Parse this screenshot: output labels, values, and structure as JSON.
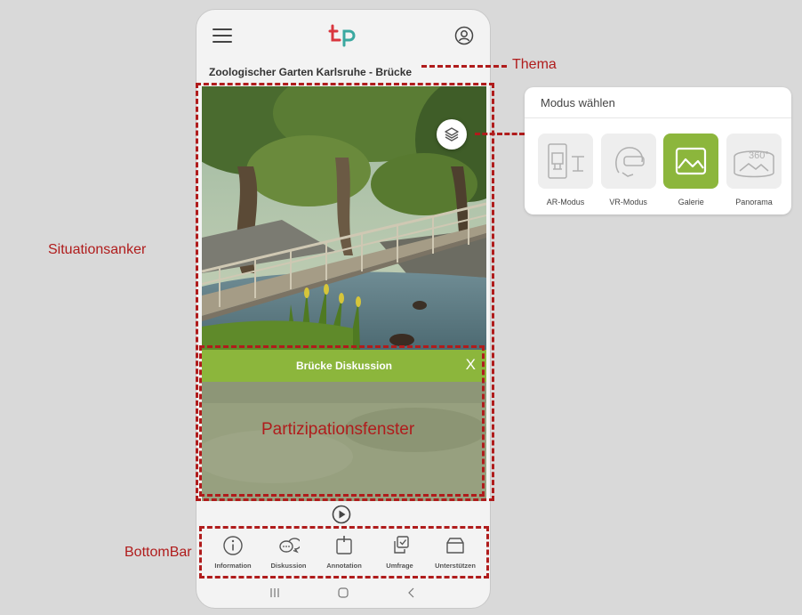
{
  "topic": "Zoologischer Garten Karlsruhe -  Brücke",
  "panel": {
    "title": "Brücke Diskussion",
    "close": "X"
  },
  "annotations": {
    "thema": "Thema",
    "situationsanker": "Situationsanker",
    "partizipationsfenster": "Partizipationsfenster",
    "bottombar": "BottomBar"
  },
  "bottom_nav": [
    {
      "label": "Information",
      "icon": "info-icon"
    },
    {
      "label": "Diskussion",
      "icon": "chat-bubbles-icon"
    },
    {
      "label": "Annotation",
      "icon": "annotation-pin-icon"
    },
    {
      "label": "Umfrage",
      "icon": "survey-check-icon"
    },
    {
      "label": "Unterstützen",
      "icon": "support-box-icon"
    }
  ],
  "mode_panel": {
    "title": "Modus wählen",
    "modes": [
      {
        "label": "AR-Modus",
        "icon": "ar-device-icon",
        "active": false
      },
      {
        "label": "VR-Modus",
        "icon": "vr-headset-icon",
        "active": false
      },
      {
        "label": "Galerie",
        "icon": "gallery-image-icon",
        "active": true
      },
      {
        "label": "Panorama",
        "icon": "panorama-360-icon",
        "active": false,
        "badge": "360°"
      }
    ]
  },
  "colors": {
    "brand_green": "#8cb63c",
    "annotation_red": "#b01c1c",
    "logo_red": "#d9363e",
    "logo_teal": "#3aa8a0"
  }
}
